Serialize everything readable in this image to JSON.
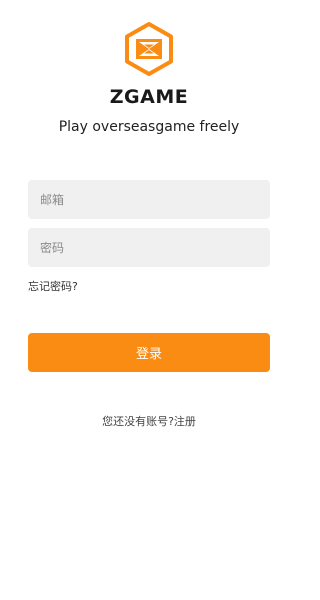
{
  "brand": {
    "logo_icon": "zgame-hexagon-logo-icon",
    "name": "ZGAME",
    "tagline": "Play overseasgame freely",
    "accent_color": "#fb8c13"
  },
  "form": {
    "email_placeholder": "邮箱",
    "email_value": "",
    "password_placeholder": "密码",
    "password_value": "",
    "forgot_label": "忘记密码?",
    "login_label": "登录"
  },
  "footer": {
    "prompt": "您还没有账号?",
    "signup_label": "注册"
  }
}
